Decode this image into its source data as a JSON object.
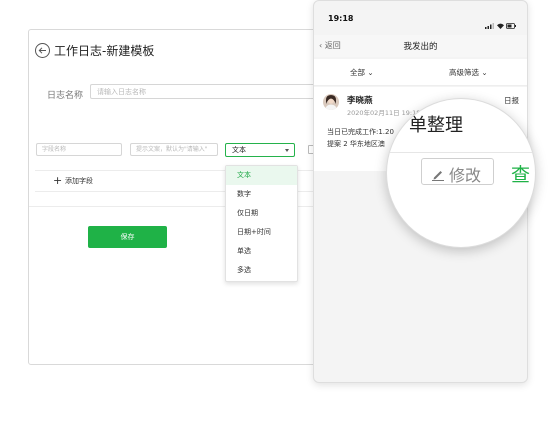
{
  "desktop": {
    "title": "工作日志-新建模板",
    "log_name_label": "日志名称",
    "log_name_placeholder": "请输入日志名称",
    "field_name_placeholder": "字段名称",
    "field_hint_placeholder": "提示文案，默认为\"请输入\"",
    "field_type_value": "文本",
    "add_field_label": "添加字段",
    "save_label": "保存",
    "type_options": [
      "文本",
      "数字",
      "仅日期",
      "日期+时间",
      "单选",
      "多选"
    ],
    "accent_color": "#1fb247"
  },
  "phone": {
    "time": "19:18",
    "back_label": "返回",
    "nav_title": "我发出的",
    "filter_all": "全部",
    "filter_advanced": "高级筛选",
    "card": {
      "user_name": "李晓燕",
      "date": "2020年02月11日 19:18",
      "tag": "日报",
      "line1": "当日已完成工作:1.20",
      "line2": "提案 2 华东地区澳"
    }
  },
  "magnifier": {
    "title": "单整理",
    "edit_label": "修改",
    "view_label": "查"
  }
}
